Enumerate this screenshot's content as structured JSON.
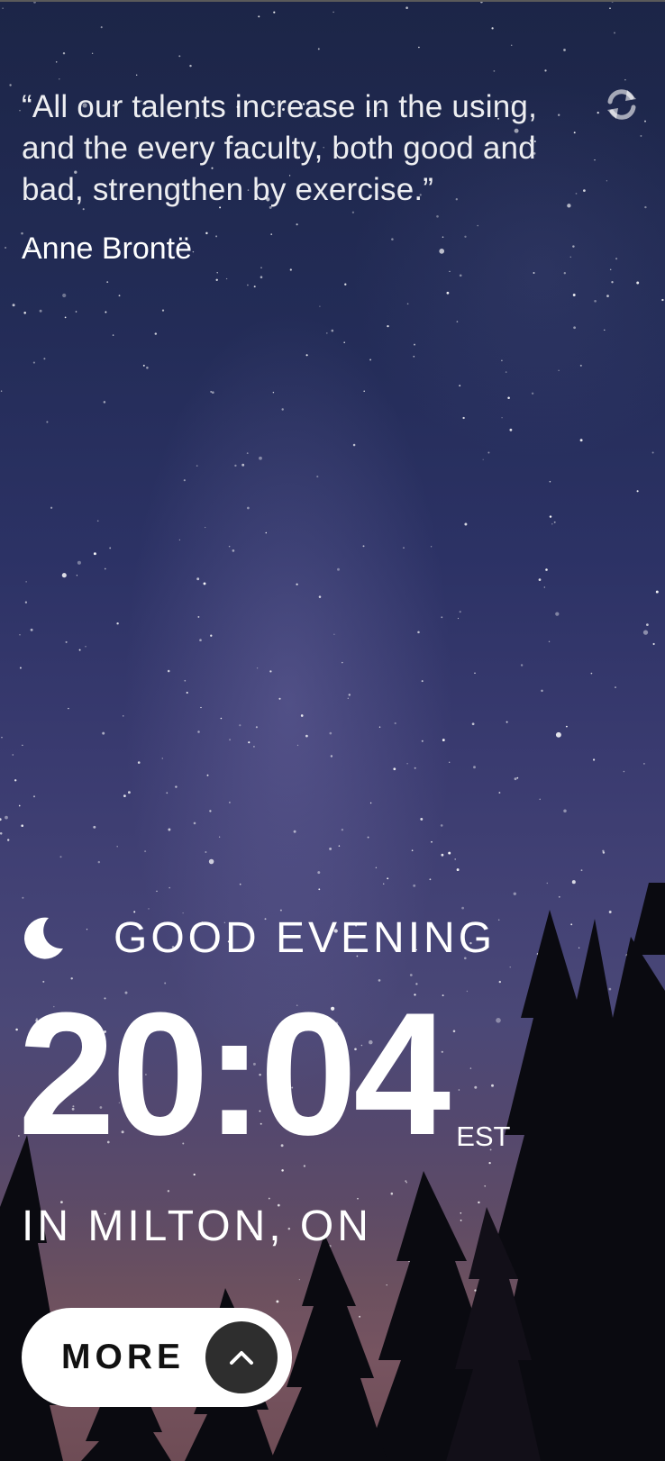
{
  "quote": {
    "text": "“All our talents increase in the using, and the every faculty, both good and bad, strengthen by exercise.”",
    "author": "Anne Brontë"
  },
  "refresh": {
    "icon": "refresh-icon"
  },
  "greeting": {
    "icon": "moon-icon",
    "text": "GOOD EVENING"
  },
  "clock": {
    "time": "20:04",
    "timezone": "EST"
  },
  "location": {
    "text": "IN MILTON, ON"
  },
  "more_button": {
    "label": "MORE",
    "icon": "chevron-up-icon"
  },
  "colors": {
    "sky_top": "#1c2547",
    "sky_bottom": "#775460",
    "text": "#ffffff",
    "button_bg": "#ffffff",
    "button_text": "#111111",
    "chevron_bg": "#2e2e2e"
  }
}
